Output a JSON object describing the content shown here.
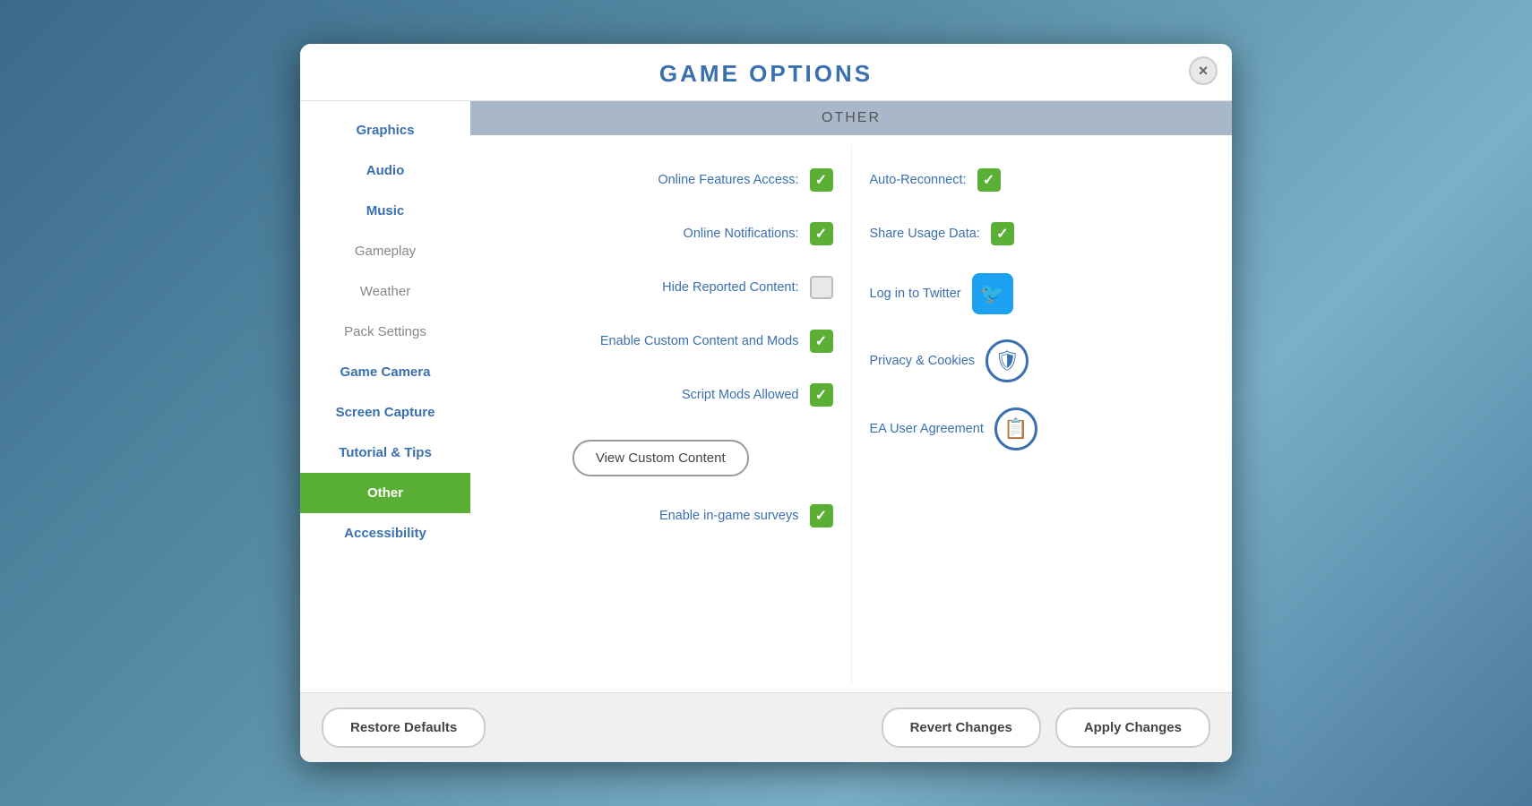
{
  "modal": {
    "title": "Game Options",
    "close_label": "×"
  },
  "sidebar": {
    "items": [
      {
        "id": "graphics",
        "label": "Graphics",
        "active": false,
        "muted": false
      },
      {
        "id": "audio",
        "label": "Audio",
        "active": false,
        "muted": false
      },
      {
        "id": "music",
        "label": "Music",
        "active": false,
        "muted": false
      },
      {
        "id": "gameplay",
        "label": "Gameplay",
        "active": false,
        "muted": true
      },
      {
        "id": "weather",
        "label": "Weather",
        "active": false,
        "muted": true
      },
      {
        "id": "pack-settings",
        "label": "Pack Settings",
        "active": false,
        "muted": true
      },
      {
        "id": "game-camera",
        "label": "Game Camera",
        "active": false,
        "muted": false
      },
      {
        "id": "screen-capture",
        "label": "Screen Capture",
        "active": false,
        "muted": false
      },
      {
        "id": "tutorial-tips",
        "label": "Tutorial & Tips",
        "active": false,
        "muted": false
      },
      {
        "id": "other",
        "label": "Other",
        "active": true,
        "muted": false
      },
      {
        "id": "accessibility",
        "label": "Accessibility",
        "active": false,
        "muted": false
      }
    ]
  },
  "section": {
    "header": "Other"
  },
  "left_options": [
    {
      "id": "online-features",
      "label": "Online Features Access:",
      "checked": true,
      "type": "checkbox"
    },
    {
      "id": "online-notifications",
      "label": "Online Notifications:",
      "checked": true,
      "type": "checkbox"
    },
    {
      "id": "hide-reported",
      "label": "Hide Reported Content:",
      "checked": false,
      "type": "checkbox"
    },
    {
      "id": "enable-custom-content",
      "label": "Enable Custom Content and Mods",
      "checked": true,
      "type": "checkbox"
    },
    {
      "id": "script-mods",
      "label": "Script Mods Allowed",
      "checked": true,
      "type": "checkbox"
    }
  ],
  "view_cc_button": "View Custom Content",
  "enable_surveys": {
    "label": "Enable in-game surveys",
    "checked": true
  },
  "right_options": [
    {
      "id": "auto-reconnect",
      "label": "Auto-Reconnect:",
      "checked": true,
      "type": "checkbox"
    },
    {
      "id": "share-usage",
      "label": "Share Usage Data:",
      "checked": true,
      "type": "checkbox"
    },
    {
      "id": "twitter",
      "label": "Log in to Twitter",
      "type": "twitter"
    },
    {
      "id": "privacy",
      "label": "Privacy & Cookies",
      "type": "shield"
    },
    {
      "id": "ea-agreement",
      "label": "EA User Agreement",
      "type": "doc"
    }
  ],
  "footer": {
    "restore_defaults": "Restore Defaults",
    "revert_changes": "Revert Changes",
    "apply_changes": "Apply Changes"
  }
}
